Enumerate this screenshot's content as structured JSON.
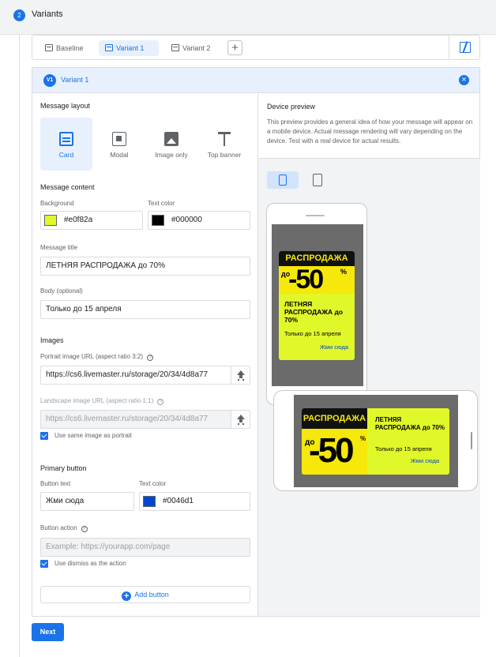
{
  "step": {
    "number": "2",
    "title": "Variants"
  },
  "tabs": [
    {
      "label": "Baseline"
    },
    {
      "label": "Variant 1"
    },
    {
      "label": "Variant 2"
    }
  ],
  "variant": {
    "badge": "V1",
    "title": "Variant 1"
  },
  "message_layout": {
    "label": "Message layout",
    "options": [
      {
        "label": "Card",
        "icon": "card-layout-icon"
      },
      {
        "label": "Modal",
        "icon": "modal-layout-icon"
      },
      {
        "label": "Image only",
        "icon": "image-icon"
      },
      {
        "label": "Top banner",
        "icon": "top-banner-icon"
      }
    ],
    "selected": "Card"
  },
  "message_content": {
    "label": "Message content",
    "background_label": "Background",
    "background_value": "#e0f82a",
    "text_color_label": "Text color",
    "text_color_value": "#000000"
  },
  "message_title": {
    "label": "Message title",
    "value": "ЛЕТНЯЯ РАСПРОДАЖА до 70%"
  },
  "body": {
    "label": "Body (optional)",
    "value": "Только до 15 апреля"
  },
  "images": {
    "label": "Images",
    "portrait_label": "Portrait image URL (aspect ratio 3:2)",
    "portrait_value": "https://cs6.livemaster.ru/storage/20/34/4d8a77",
    "landscape_label": "Landscape image URL (aspect ratio 1:1)",
    "landscape_value": "https://cs6.livemaster.ru/storage/20/34/4d8a77",
    "same_image_label": "Use same image as portrait"
  },
  "primary_button": {
    "label": "Primary button",
    "button_text_label": "Button text",
    "button_text_value": "Жми сюда",
    "text_color_label": "Text color",
    "text_color_value": "#0046d1",
    "action_label": "Button action",
    "action_placeholder": "Example: https://yourapp.com/page",
    "dismiss_label": "Use dismiss as the action"
  },
  "add_button_label": "Add button",
  "device_preview": {
    "title": "Device preview",
    "description": "This preview provides a general idea of how your message will appear on a mobile device. Actual message rendering will vary depending on the device. Test with a real device for actual results."
  },
  "promo_image": {
    "headline": "РАСПРОДАЖА",
    "prefix": "до",
    "amount": "-50",
    "percent": "%"
  },
  "next_label": "Next",
  "colors": {
    "accent": "#1a73e8",
    "card_background": "#e0f82a",
    "button_text": "#0046d1"
  }
}
